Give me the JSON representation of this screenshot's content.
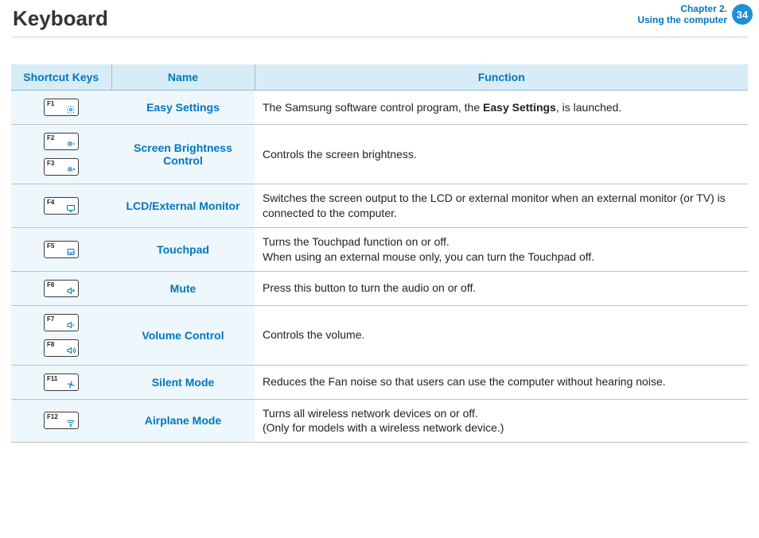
{
  "header": {
    "title": "Keyboard",
    "chapter_line1": "Chapter 2.",
    "chapter_line2": "Using the computer",
    "page_number": "34"
  },
  "table": {
    "headers": {
      "keys": "Shortcut Keys",
      "name": "Name",
      "func": "Function"
    },
    "rows": [
      {
        "keys": [
          {
            "label": "F1",
            "icon": "settings-icon"
          }
        ],
        "name": "Easy Settings",
        "function_html": "The Samsung software control program, the <b>Easy Settings</b>, is launched."
      },
      {
        "keys": [
          {
            "label": "F2",
            "icon": "brightness-down-icon"
          },
          {
            "label": "F3",
            "icon": "brightness-up-icon"
          }
        ],
        "name": "Screen Brightness Control",
        "function_html": "Controls the screen brightness."
      },
      {
        "keys": [
          {
            "label": "F4",
            "icon": "display-icon"
          }
        ],
        "name": "LCD/External Monitor",
        "function_html": "Switches the screen output to the LCD or external monitor when an external monitor (or TV) is connected to the computer."
      },
      {
        "keys": [
          {
            "label": "F5",
            "icon": "touchpad-icon"
          }
        ],
        "name": "Touchpad",
        "function_html": "Turns the Touchpad function on or off.<br>When using an external mouse only, you can turn the Touchpad off."
      },
      {
        "keys": [
          {
            "label": "F6",
            "icon": "mute-icon"
          }
        ],
        "name": "Mute",
        "function_html": "Press this button to turn the audio on or off."
      },
      {
        "keys": [
          {
            "label": "F7",
            "icon": "volume-down-icon"
          },
          {
            "label": "F8",
            "icon": "volume-up-icon"
          }
        ],
        "name": "Volume Control",
        "function_html": "Controls the volume."
      },
      {
        "keys": [
          {
            "label": "F11",
            "icon": "fan-icon"
          }
        ],
        "name": "Silent Mode",
        "function_html": "Reduces the Fan noise so that users can use the computer without hearing noise."
      },
      {
        "keys": [
          {
            "label": "F12",
            "icon": "wifi-icon"
          }
        ],
        "name": "Airplane Mode",
        "function_html": "Turns all wireless network devices on or off.<br>(Only for models with a wireless network device.)"
      }
    ]
  }
}
